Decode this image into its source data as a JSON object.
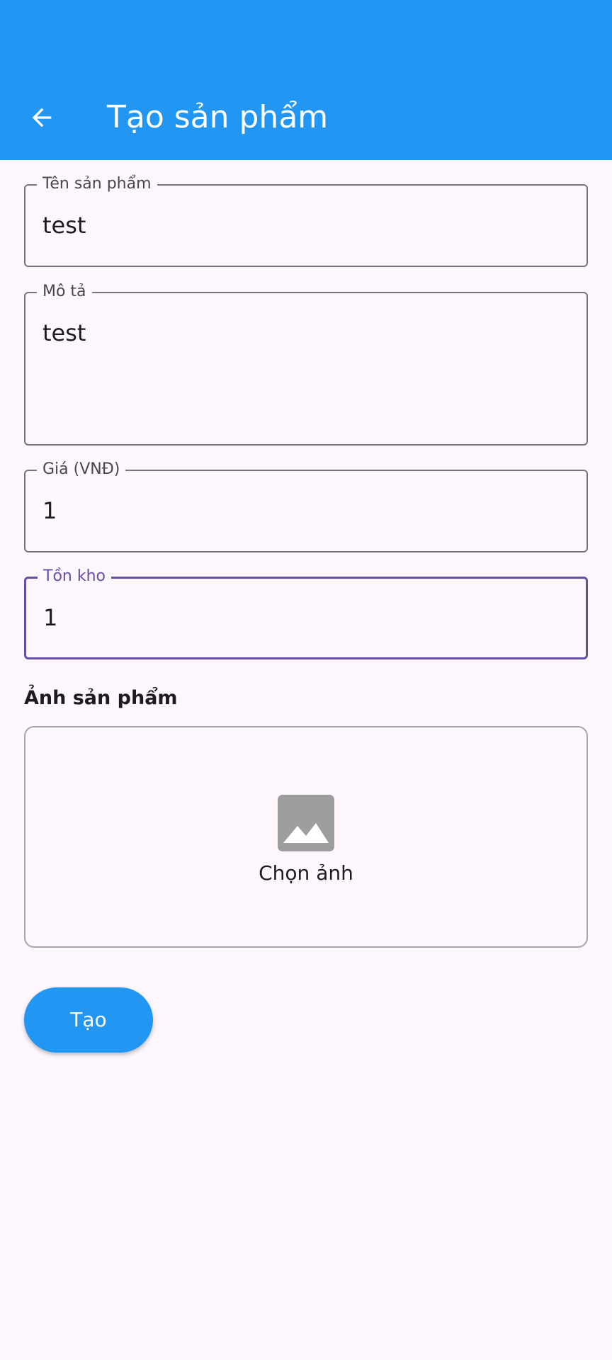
{
  "appbar": {
    "title": "Tạo sản phẩm",
    "back_icon": "arrow-back-icon",
    "color": "#2196f3"
  },
  "form": {
    "name": {
      "label": "Tên sản phẩm",
      "value": "test"
    },
    "description": {
      "label": "Mô tả",
      "value": "test"
    },
    "price": {
      "label": "Giá (VNĐ)",
      "value": "1"
    },
    "stock": {
      "label": "Tồn kho",
      "value": "1",
      "focused": true
    }
  },
  "image_section": {
    "title": "Ảnh sản phẩm",
    "picker_label": "Chọn ảnh",
    "icon": "image-icon"
  },
  "actions": {
    "create_label": "Tạo"
  },
  "colors": {
    "primary": "#2196f3",
    "focus": "#6750a4",
    "background": "#fdf6fd"
  }
}
